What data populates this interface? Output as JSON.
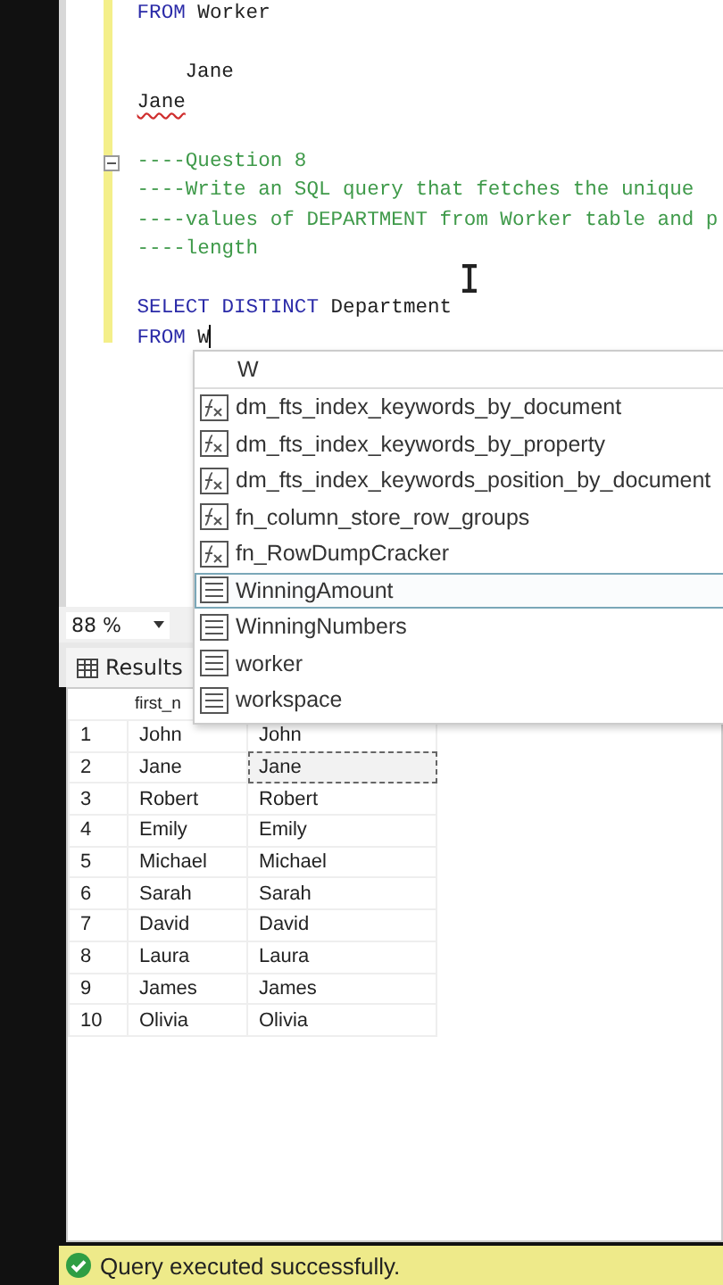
{
  "editor": {
    "blocks": [
      {
        "kind": "plain",
        "lines": [
          {
            "kind": "code",
            "tokens": [
              {
                "kind": "keyword",
                "text": "FROM"
              },
              {
                "kind": "plain",
                "text": " Worker"
              }
            ]
          }
        ]
      },
      {
        "kind": "plain",
        "lines": [
          {
            "kind": "indented",
            "tokens": [
              {
                "kind": "plain",
                "text": "Jane"
              }
            ]
          },
          {
            "kind": "misspelled",
            "tokens": [
              {
                "kind": "plain",
                "text": "Jane"
              }
            ]
          }
        ]
      },
      {
        "kind": "region",
        "lines": [
          {
            "kind": "code",
            "tokens": [
              {
                "kind": "comment",
                "text": "----Question 8"
              }
            ]
          },
          {
            "kind": "code",
            "tokens": [
              {
                "kind": "comment",
                "text": "----Write an SQL query that fetches the unique"
              }
            ]
          },
          {
            "kind": "code",
            "tokens": [
              {
                "kind": "comment",
                "text": "----values of DEPARTMENT from Worker table and p"
              }
            ]
          },
          {
            "kind": "code",
            "tokens": [
              {
                "kind": "comment",
                "text": "----length"
              }
            ]
          }
        ]
      },
      {
        "kind": "plain",
        "lines": [
          {
            "kind": "code",
            "tokens": [
              {
                "kind": "keyword",
                "text": "SELECT DISTINCT"
              },
              {
                "kind": "plain",
                "text": " Department"
              }
            ]
          },
          {
            "kind": "with_caret",
            "tokens": [
              {
                "kind": "keyword",
                "text": "FROM"
              },
              {
                "kind": "plain",
                "text": " W"
              }
            ]
          }
        ]
      }
    ]
  },
  "autocomplete": {
    "filter": "W",
    "items": [
      {
        "kind": "function",
        "label": "dm_fts_index_keywords_by_document",
        "selected": false
      },
      {
        "kind": "function",
        "label": "dm_fts_index_keywords_by_property",
        "selected": false
      },
      {
        "kind": "function",
        "label": "dm_fts_index_keywords_position_by_document",
        "selected": false
      },
      {
        "kind": "function",
        "label": "fn_column_store_row_groups",
        "selected": false
      },
      {
        "kind": "function",
        "label": "fn_RowDumpCracker",
        "selected": false
      },
      {
        "kind": "table",
        "label": "WinningAmount",
        "selected": true
      },
      {
        "kind": "table",
        "label": "WinningNumbers",
        "selected": false
      },
      {
        "kind": "table",
        "label": "worker",
        "selected": false
      },
      {
        "kind": "table",
        "label": "workspace",
        "selected": false
      }
    ]
  },
  "zoom": "88 %",
  "results_tab": "Results",
  "grid": {
    "column_1": "first_n",
    "rows": [
      {
        "number": "1",
        "column_1": "John",
        "column_2": "John",
        "selected": false
      },
      {
        "number": "2",
        "column_1": "Jane",
        "column_2": "Jane",
        "selected": true
      },
      {
        "number": "3",
        "column_1": "Robert",
        "column_2": "Robert",
        "selected": false
      },
      {
        "number": "4",
        "column_1": "Emily",
        "column_2": "Emily",
        "selected": false
      },
      {
        "number": "5",
        "column_1": "Michael",
        "column_2": "Michael",
        "selected": false
      },
      {
        "number": "6",
        "column_1": "Sarah",
        "column_2": "Sarah",
        "selected": false
      },
      {
        "number": "7",
        "column_1": "David",
        "column_2": "David",
        "selected": false
      },
      {
        "number": "8",
        "column_1": "Laura",
        "column_2": "Laura",
        "selected": false
      },
      {
        "number": "9",
        "column_1": "James",
        "column_2": "James",
        "selected": false
      },
      {
        "number": "10",
        "column_1": "Olivia",
        "column_2": "Olivia",
        "selected": false
      }
    ]
  },
  "status_bar": {
    "message": "Query executed successfully."
  }
}
